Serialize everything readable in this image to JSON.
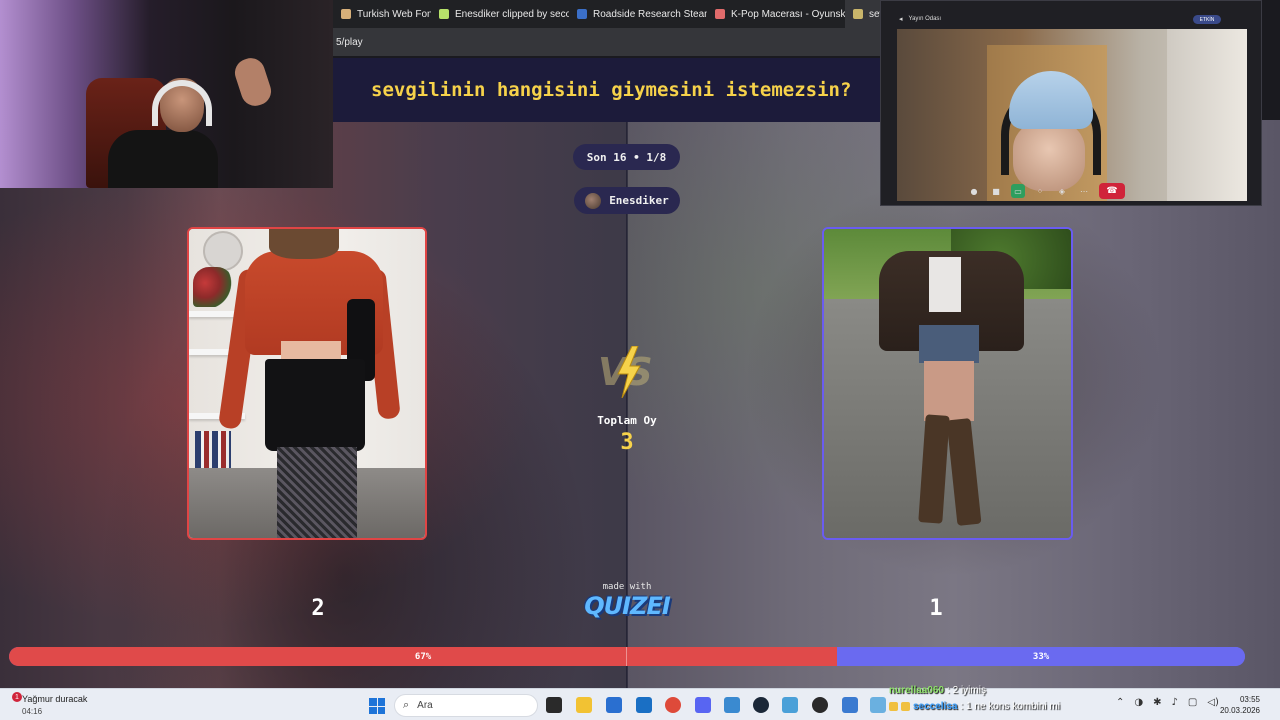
{
  "browser": {
    "tabs": [
      {
        "label": "Turkish Web Fon M",
        "color": "#d7b07a"
      },
      {
        "label": "Enesdiker clipped by seco",
        "color": "#b7e36a"
      },
      {
        "label": "Roadside Research Steam",
        "color": "#3b6fc8"
      },
      {
        "label": "K-Pop Macerası - Oyunsk",
        "color": "#e06b6b"
      },
      {
        "label": "sev",
        "color": "#c9b56a"
      }
    ],
    "address": "5/play",
    "tab_close": "×"
  },
  "quiz": {
    "question": "sevgilinin hangisini giymesini istemezsin?",
    "round": "Son 16 • 1/8",
    "creator": "Enesdiker",
    "total_label": "Toplam Oy",
    "total_votes": "3",
    "made_with": "made with",
    "brand": "QUIZEI",
    "left_votes": "2",
    "right_votes": "1",
    "left_percent": "67%",
    "right_percent": "33%",
    "left_fraction": 0.67,
    "accent_yellow": "#f6d24a",
    "left_color": "#e04a4a",
    "right_color": "#6a6af0"
  },
  "call": {
    "title": "Yayın Odası",
    "badge": "ETKİN",
    "end_icon": "phone-hangup-icon"
  },
  "taskbar": {
    "weather_text": "Yağmur duracak",
    "weather_time": "04:16",
    "notification_count": "1",
    "search_placeholder": "Ara",
    "time": "03:55",
    "date": "20.03.2026"
  },
  "chat": [
    {
      "user": "nurellaa060",
      "message": ": 2 iyimiş"
    },
    {
      "user": "seccelisa",
      "message": ": 1 ne kons kombini mi"
    }
  ]
}
